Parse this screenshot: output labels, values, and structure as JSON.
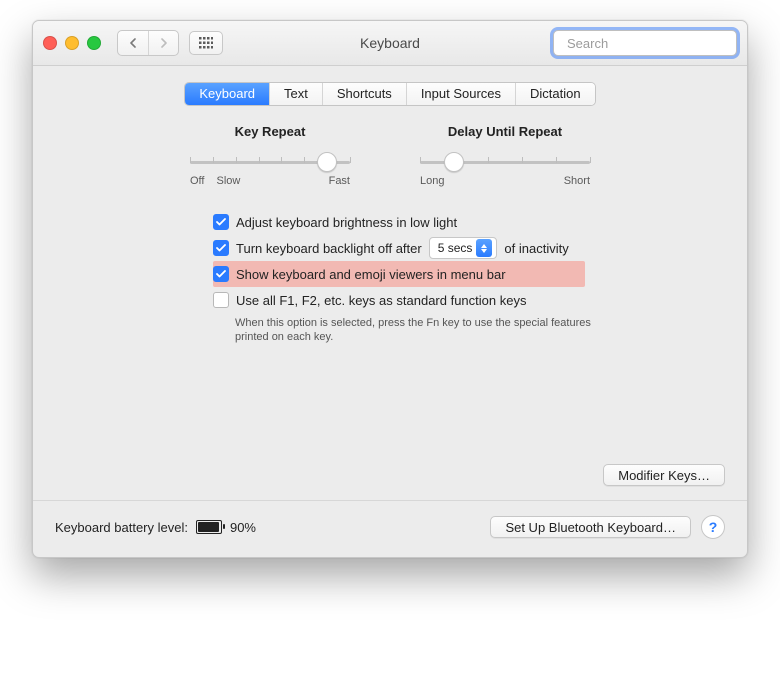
{
  "window": {
    "title": "Keyboard"
  },
  "search": {
    "placeholder": "Search"
  },
  "tabs": {
    "items": [
      "Keyboard",
      "Text",
      "Shortcuts",
      "Input Sources",
      "Dictation"
    ],
    "selected_index": 0
  },
  "sliders": {
    "key_repeat": {
      "title": "Key Repeat",
      "left_label_1": "Off",
      "left_label_2": "Slow",
      "right_label": "Fast",
      "ticks": 8,
      "value_index": 6
    },
    "delay_until_repeat": {
      "title": "Delay Until Repeat",
      "left_label": "Long",
      "right_label": "Short",
      "ticks": 6,
      "value_index": 1
    }
  },
  "options": {
    "adjust_brightness": {
      "checked": true,
      "label": "Adjust keyboard brightness in low light"
    },
    "backlight_off": {
      "checked": true,
      "label_before": "Turn keyboard backlight off after",
      "select_value": "5 secs",
      "label_after": "of inactivity"
    },
    "show_viewers": {
      "checked": true,
      "label": "Show keyboard and emoji viewers in menu bar"
    },
    "function_keys": {
      "checked": false,
      "label": "Use all F1, F2, etc. keys as standard function keys",
      "hint": "When this option is selected, press the Fn key to use the special features printed on each key."
    }
  },
  "buttons": {
    "modifier_keys": "Modifier Keys…",
    "bluetooth": "Set Up Bluetooth Keyboard…"
  },
  "battery": {
    "label": "Keyboard battery level:",
    "percent": "90%"
  },
  "help": "?"
}
